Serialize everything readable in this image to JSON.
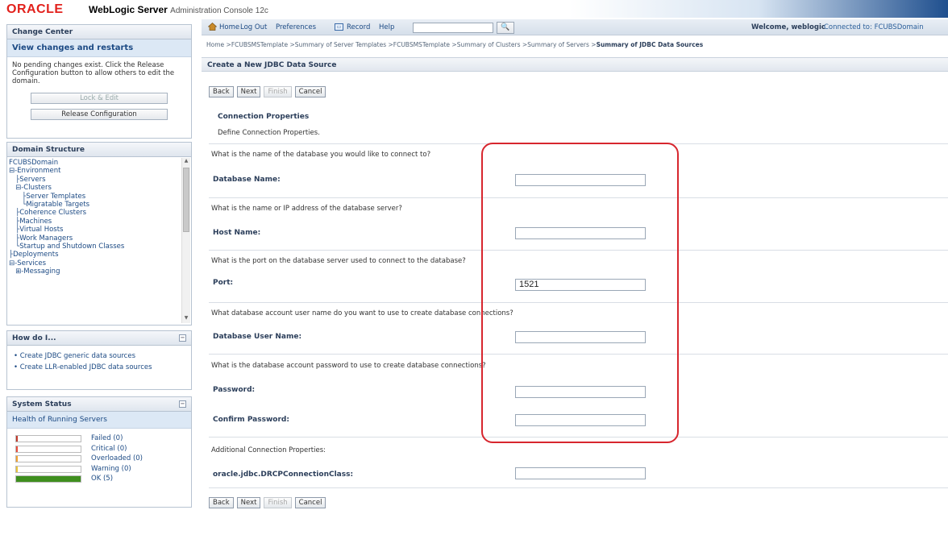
{
  "header": {
    "brand": "ORACLE",
    "product_bold": "WebLogic Server",
    "product_rest": "Administration Console 12c"
  },
  "change_center": {
    "title": "Change Center",
    "subtitle": "View changes and restarts",
    "message": "No pending changes exist. Click the Release Configuration button to allow others to edit the domain.",
    "lock_button": "Lock & Edit",
    "release_button": "Release Configuration"
  },
  "domain_structure": {
    "title": "Domain Structure",
    "items": [
      "FCUBSDomain",
      "⊟-Environment",
      "   ├Servers",
      "   ⊟-Clusters",
      "      ├Server Templates",
      "      └Migratable Targets",
      "   ├Coherence Clusters",
      "   ├Machines",
      "   ├Virtual Hosts",
      "   ├Work Managers",
      "   └Startup and Shutdown Classes",
      "├Deployments",
      "⊟-Services",
      "   ⊞-Messaging"
    ]
  },
  "how_do_i": {
    "title": "How do I...",
    "links": [
      "Create JDBC generic data sources",
      "Create LLR-enabled JDBC data sources"
    ]
  },
  "system_status": {
    "title": "System Status",
    "subtitle": "Health of Running Servers",
    "rows": [
      {
        "label": "Failed (0)",
        "color": "#c0392b",
        "fraction": 0
      },
      {
        "label": "Critical (0)",
        "color": "#e74c3c",
        "fraction": 0
      },
      {
        "label": "Overloaded (0)",
        "color": "#f0a030",
        "fraction": 0
      },
      {
        "label": "Warning (0)",
        "color": "#e8c23a",
        "fraction": 0
      },
      {
        "label": "OK (5)",
        "color": "#3f8f1e",
        "fraction": 1
      }
    ]
  },
  "toolbar": {
    "home": "Home",
    "logout": "Log Out",
    "preferences": "Preferences",
    "record": "Record",
    "help": "Help",
    "search_value": "",
    "welcome": "Welcome, weblogic",
    "connected": "Connected to: FCUBSDomain"
  },
  "breadcrumb": {
    "path": "Home >FCUBSMSTemplate >Summary of Server Templates >FCUBSMSTemplate >Summary of Clusters >Summary of Servers >",
    "current": "Summary of JDBC Data Sources"
  },
  "page": {
    "title": "Create a New JDBC Data Source",
    "buttons": {
      "back": "Back",
      "next": "Next",
      "finish": "Finish",
      "cancel": "Cancel"
    },
    "section_title": "Connection Properties",
    "section_desc": "Define Connection Properties."
  },
  "form": {
    "q_database": "What is the name of the database you would like to connect to?",
    "label_database": "Database Name:",
    "value_database": "",
    "q_host": "What is the name or IP address of the database server?",
    "label_host": "Host Name:",
    "value_host": "",
    "q_port": "What is the port on the database server used to connect to the database?",
    "label_port": "Port:",
    "value_port": "1521",
    "q_user": "What database account user name do you want to use to create database connections?",
    "label_user": "Database User Name:",
    "value_user": "",
    "q_password": "What is the database account password to use to create database connections?",
    "label_password": "Password:",
    "value_password": "",
    "label_confirm": "Confirm Password:",
    "value_confirm": "",
    "additional": "Additional Connection Properties:",
    "label_drcp": "oracle.jdbc.DRCPConnectionClass:",
    "value_drcp": ""
  },
  "colors": {
    "highlight": "#d7262e",
    "brand": "#e2211c"
  }
}
